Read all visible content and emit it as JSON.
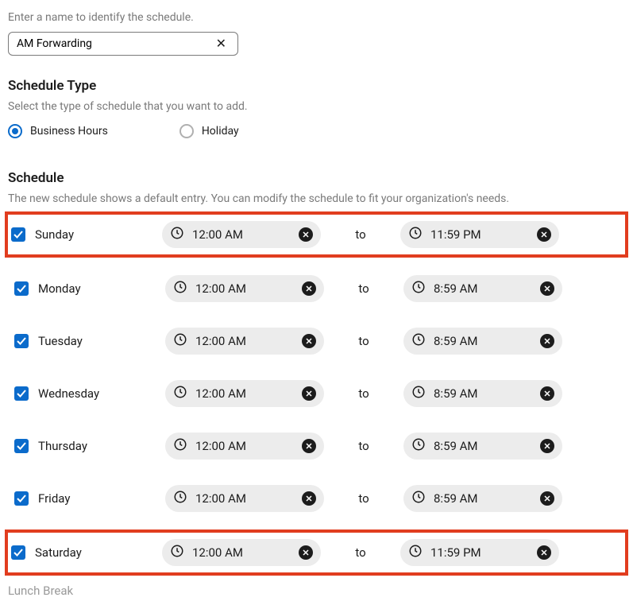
{
  "name_section": {
    "help": "Enter a name to identify the schedule.",
    "value": "AM Forwarding"
  },
  "schedule_type": {
    "title": "Schedule Type",
    "help": "Select the type of schedule that you want to add.",
    "options": [
      {
        "label": "Business Hours",
        "selected": true
      },
      {
        "label": "Holiday",
        "selected": false
      }
    ]
  },
  "schedule": {
    "title": "Schedule",
    "help": "The new schedule shows a default entry. You can modify the schedule to fit your organization's needs.",
    "to_label": "to",
    "days": [
      {
        "name": "Sunday",
        "checked": true,
        "start": "12:00 AM",
        "end": "11:59 PM",
        "highlight": true
      },
      {
        "name": "Monday",
        "checked": true,
        "start": "12:00 AM",
        "end": "8:59 AM",
        "highlight": false
      },
      {
        "name": "Tuesday",
        "checked": true,
        "start": "12:00 AM",
        "end": "8:59 AM",
        "highlight": false
      },
      {
        "name": "Wednesday",
        "checked": true,
        "start": "12:00 AM",
        "end": "8:59 AM",
        "highlight": false
      },
      {
        "name": "Thursday",
        "checked": true,
        "start": "12:00 AM",
        "end": "8:59 AM",
        "highlight": false
      },
      {
        "name": "Friday",
        "checked": true,
        "start": "12:00 AM",
        "end": "8:59 AM",
        "highlight": false
      },
      {
        "name": "Saturday",
        "checked": true,
        "start": "12:00 AM",
        "end": "11:59 PM",
        "highlight": true
      }
    ]
  },
  "lunch_break_label": "Lunch Break"
}
